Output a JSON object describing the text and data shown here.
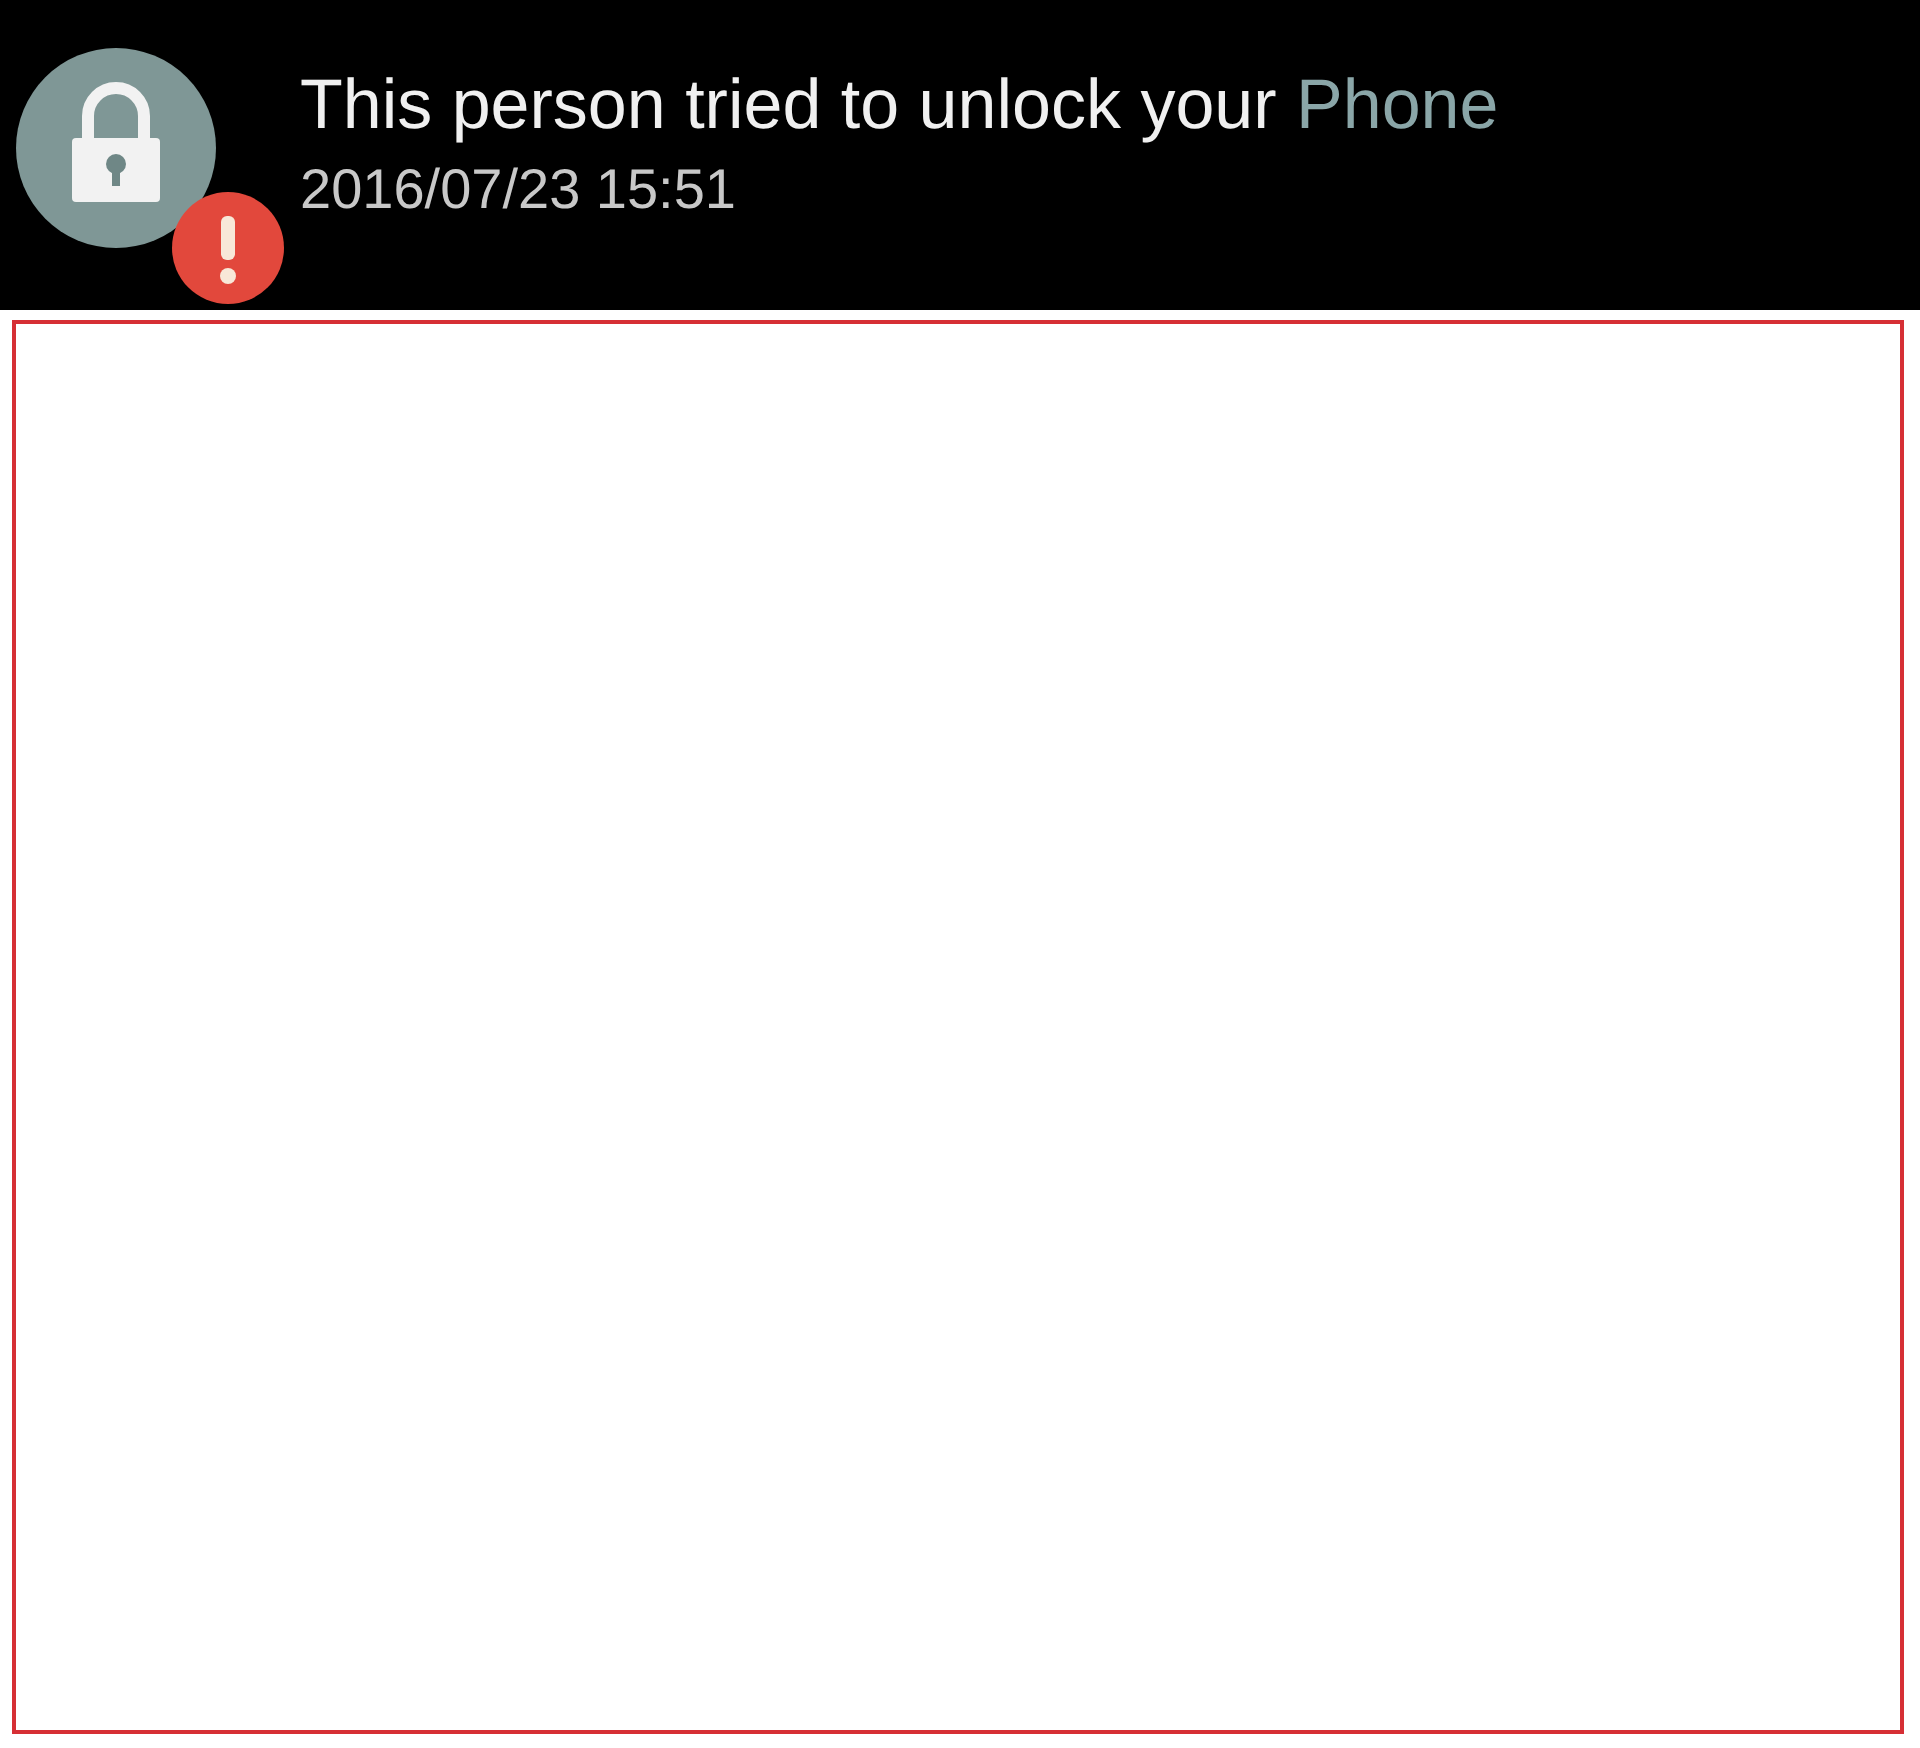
{
  "notification": {
    "title": "This person tried to unlock your",
    "title_highlight": "Phone",
    "timestamp": "2016/07/23 15:51",
    "alert": true
  }
}
